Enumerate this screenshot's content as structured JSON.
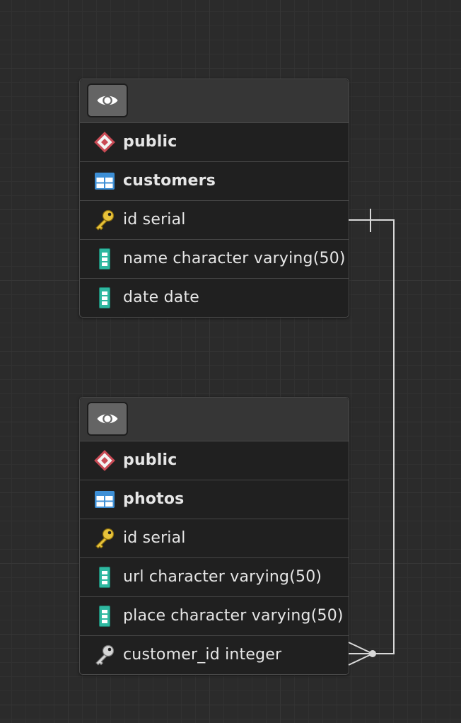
{
  "tables": [
    {
      "id": "customers",
      "schema": "public",
      "name": "customers",
      "columns": [
        {
          "text": "id serial",
          "icon": "primary-key-icon"
        },
        {
          "text": "name character varying(50)",
          "icon": "column-icon"
        },
        {
          "text": "date date",
          "icon": "column-icon"
        }
      ]
    },
    {
      "id": "photos",
      "schema": "public",
      "name": "photos",
      "columns": [
        {
          "text": "id serial",
          "icon": "primary-key-icon"
        },
        {
          "text": "url character varying(50)",
          "icon": "column-icon"
        },
        {
          "text": "place character varying(50)",
          "icon": "column-icon"
        },
        {
          "text": "customer_id integer",
          "icon": "foreign-key-icon"
        }
      ]
    }
  ],
  "relationships": [
    {
      "from": "photos.customer_id",
      "to": "customers.id",
      "from_cardinality": "many",
      "to_cardinality": "one"
    }
  ],
  "colors": {
    "background": "#2b2b2b",
    "schema_icon": "#c94a55",
    "table_icon": "#3d8fd6",
    "primary_key_icon": "#e8c33a",
    "column_icon": "#2fb8a0",
    "foreign_key_icon": "#bdbdbd",
    "relationship_line": "#d9d9d9"
  }
}
